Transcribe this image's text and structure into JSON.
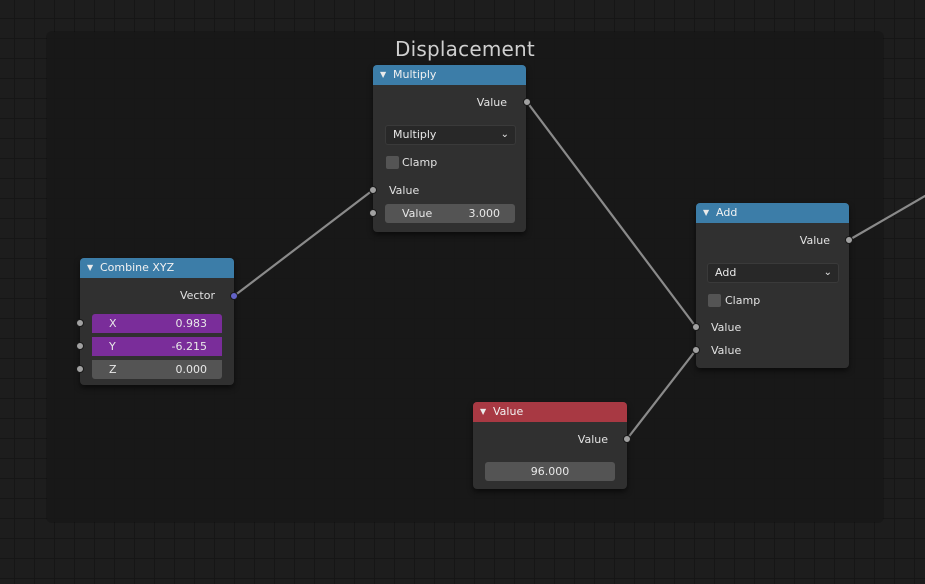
{
  "frame": {
    "title": "Displacement"
  },
  "nodes": {
    "multiply": {
      "title": "Multiply",
      "output_label": "Value",
      "operation": "Multiply",
      "clamp_label": "Clamp",
      "clamp_checked": false,
      "input_label": "Value",
      "value_field_label": "Value",
      "value_field_value": "3.000"
    },
    "combine_xyz": {
      "title": "Combine XYZ",
      "output_label": "Vector",
      "fields": [
        {
          "label": "X",
          "value": "0.983"
        },
        {
          "label": "Y",
          "value": "-6.215"
        },
        {
          "label": "Z",
          "value": "0.000"
        }
      ]
    },
    "add": {
      "title": "Add",
      "output_label": "Value",
      "operation": "Add",
      "clamp_label": "Clamp",
      "clamp_checked": false,
      "input_labels": [
        "Value",
        "Value"
      ]
    },
    "value": {
      "title": "Value",
      "output_label": "Value",
      "value": "96.000"
    }
  },
  "colors": {
    "header_math": "#3c7da8",
    "header_input": "#a83943",
    "field_connected": "#7a2d9a",
    "socket_float": "#a1a1a1",
    "socket_vector": "#6363c7"
  },
  "icons": {
    "collapse": "▼",
    "dropdown": "⌄"
  }
}
